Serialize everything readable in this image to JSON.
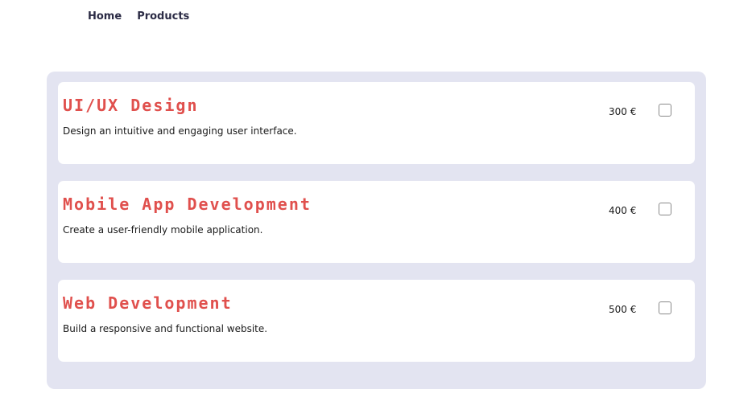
{
  "nav": {
    "items": [
      {
        "label": "Home"
      },
      {
        "label": "Products"
      }
    ]
  },
  "products": [
    {
      "title": "UI/UX Design",
      "description": "Design an intuitive and engaging user interface.",
      "price": "300 €",
      "selected": false
    },
    {
      "title": "Mobile App Development",
      "description": "Create a user-friendly mobile application.",
      "price": "400 €",
      "selected": false
    },
    {
      "title": "Web Development",
      "description": "Build a responsive and functional website.",
      "price": "500 €",
      "selected": false
    }
  ],
  "colors": {
    "title": "#e0504d",
    "nav_text": "#2b2b45",
    "panel_bg": "#e3e4f1",
    "card_bg": "#ffffff"
  }
}
